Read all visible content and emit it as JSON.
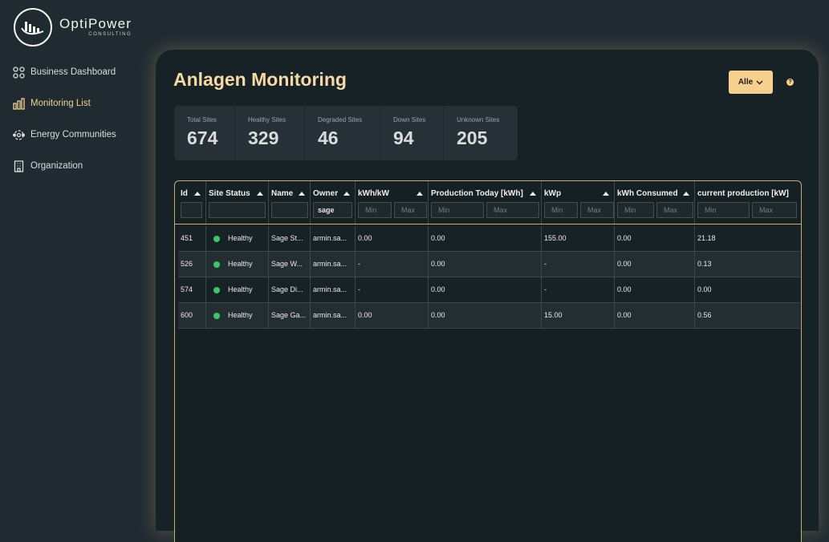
{
  "brand": {
    "name": "OptiPower",
    "sub": "CONSULTING"
  },
  "nav": [
    {
      "label": "Business Dashboard",
      "icon": "grid-icon",
      "active": false
    },
    {
      "label": "Monitoring List",
      "icon": "bar-chart-icon",
      "active": true
    },
    {
      "label": "Energy Communities",
      "icon": "community-icon",
      "active": false
    },
    {
      "label": "Organization",
      "icon": "building-icon",
      "active": false
    }
  ],
  "page": {
    "title": "Anlagen Monitoring",
    "filter_label": "Alle",
    "help": "?"
  },
  "stats": [
    {
      "label": "Total Sites",
      "value": "674"
    },
    {
      "label": "Healthy Sites",
      "value": "329"
    },
    {
      "label": "Degraded Sites",
      "value": "46"
    },
    {
      "label": "Down Sites",
      "value": "94"
    },
    {
      "label": "Unknown Sites",
      "value": "205"
    }
  ],
  "table": {
    "columns": [
      {
        "label": "Id"
      },
      {
        "label": "Site Status"
      },
      {
        "label": "Name"
      },
      {
        "label": "Owner"
      },
      {
        "label": "kWh/kW"
      },
      {
        "label": "Production Today [kWh]"
      },
      {
        "label": "kWp"
      },
      {
        "label": "kWh Consumed"
      },
      {
        "label": "current production [kW]"
      }
    ],
    "filters": {
      "owner_value": "sage",
      "min_placeholder": "Min",
      "max_placeholder": "Max"
    },
    "status_color": "#39c76c",
    "rows": [
      {
        "id": "451",
        "status": "Healthy",
        "name": "Sage St...",
        "owner": "armin.sa...",
        "kwh_kw": "0.00",
        "prod_today": "0.00",
        "kwp": "155.00",
        "consumed": "0.00",
        "current": "21.18"
      },
      {
        "id": "526",
        "status": "Healthy",
        "name": "Sage W...",
        "owner": "armin.sa...",
        "kwh_kw": "-",
        "prod_today": "0.00",
        "kwp": "-",
        "consumed": "0.00",
        "current": "0.13"
      },
      {
        "id": "574",
        "status": "Healthy",
        "name": "Sage Di...",
        "owner": "armin.sa...",
        "kwh_kw": "-",
        "prod_today": "0.00",
        "kwp": "-",
        "consumed": "0.00",
        "current": "0.00"
      },
      {
        "id": "600",
        "status": "Healthy",
        "name": "Sage Ga...",
        "owner": "armin.sa...",
        "kwh_kw": "0.00",
        "prod_today": "0.00",
        "kwp": "15.00",
        "consumed": "0.00",
        "current": "0.56"
      }
    ]
  }
}
